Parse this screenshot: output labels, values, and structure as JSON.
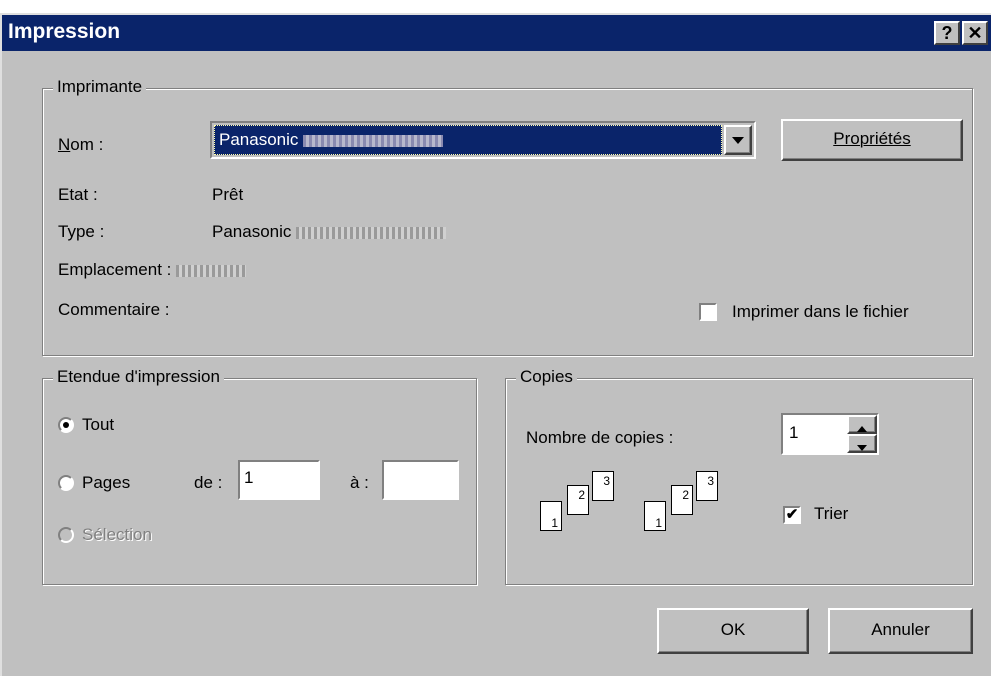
{
  "titlebar": {
    "title": "Impression",
    "help_label": "?",
    "close_label": "✕"
  },
  "printer": {
    "legend": "Imprimante",
    "name_label": "Nom :",
    "name_value": "Panasonic",
    "properties_label": "Propriétés",
    "status_label": "Etat :",
    "status_value": "Prêt",
    "type_label": "Type :",
    "type_value": "Panasonic",
    "location_label": "Emplacement :",
    "comment_label": "Commentaire :",
    "print_to_file_label": "Imprimer dans le fichier"
  },
  "range": {
    "legend": "Etendue d'impression",
    "all_label": "Tout",
    "pages_label": "Pages",
    "from_label": "de :",
    "from_value": "1",
    "to_label": "à :",
    "to_value": "",
    "selection_label": "Sélection"
  },
  "copies": {
    "legend": "Copies",
    "count_label": "Nombre de copies :",
    "count_value": "1",
    "collate_label": "Trier",
    "collate_checked": true,
    "stack_pages": [
      "1",
      "2",
      "3"
    ]
  },
  "footer": {
    "ok_label": "OK",
    "cancel_label": "Annuler"
  }
}
